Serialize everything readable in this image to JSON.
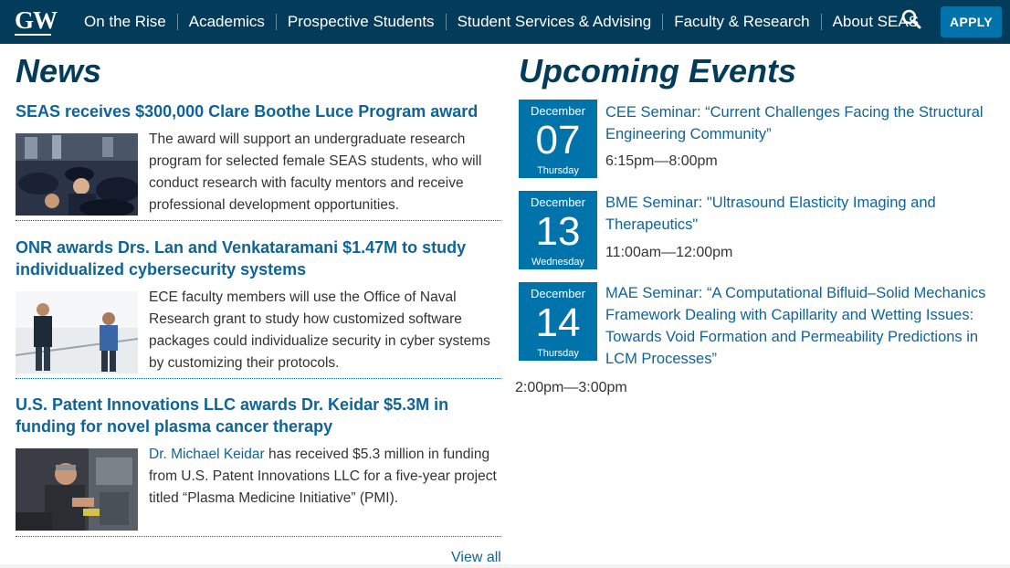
{
  "header": {
    "logo_text": "GW",
    "nav_items": [
      "On the Rise",
      "Academics",
      "Prospective Students",
      "Student Services & Advising",
      "Faculty & Research",
      "About SEAS"
    ],
    "search_icon": "search-icon",
    "apply_label": "APPLY"
  },
  "news": {
    "title": "News",
    "items": [
      {
        "headline": "SEAS receives $300,000 Clare Boothe Luce Program award",
        "summary": "The award will support an undergraduate research program for selected female SEAS students, who will conduct research with faculty mentors and receive professional development opportunities."
      },
      {
        "headline": "ONR awards Drs. Lan and Venkataramani $1.47M to study individualized cybersecurity systems",
        "summary": "ECE faculty members will use the Office of Naval Research grant to study how customized software packages could individualize security in cyber systems by customizing their protocols."
      },
      {
        "headline": "U.S. Patent Innovations LLC awards Dr. Keidar $5.3M in funding for novel plasma cancer therapy",
        "link_text": "Dr. Michael Keidar",
        "summary": " has received $5.3 million in funding from U.S. Patent Innovations LLC for a five-year project titled “Plasma Medicine Initiative” (PMI)."
      }
    ],
    "view_all": "View all"
  },
  "events": {
    "title": "Upcoming Events",
    "items": [
      {
        "month": "December",
        "day": "07",
        "weekday": "Thursday",
        "title": "CEE Seminar: “Current Challenges Facing the Structural Engineering Community”",
        "time": "6:15pm—8:00pm"
      },
      {
        "month": "December",
        "day": "13",
        "weekday": "Wednesday",
        "title": "BME Seminar: \"Ultrasound Elasticity Imaging and Therapeutics\"",
        "time": "11:00am—12:00pm"
      },
      {
        "month": "December",
        "day": "14",
        "weekday": "Thursday",
        "title": "MAE Seminar: “A Computational Bifluid–Solid Mechanics Framework Dealing with Capillarity and Wetting Issues: Towards Void Formation and Permeability Predictions in LCM Processes”",
        "time": "2:00pm—3:00pm"
      }
    ]
  },
  "colors": {
    "header_bg": "#033c5a",
    "accent": "#0073aa",
    "link": "#0f6497"
  }
}
